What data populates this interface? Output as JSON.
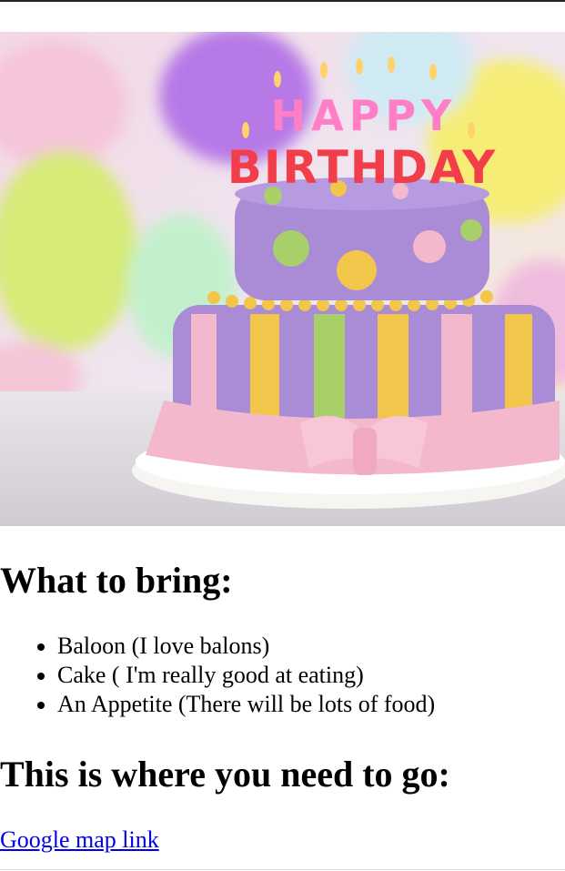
{
  "hero": {
    "candle_text_top": "HAPPY",
    "candle_text_bottom": "BIRTHDAY"
  },
  "bring": {
    "heading": "What to bring:",
    "items": [
      "Baloon (I love balons)",
      "Cake ( I'm really good at eating)",
      "An Appetite (There will be lots of food)"
    ]
  },
  "directions": {
    "heading": "This is where you need to go:",
    "link_label": "Google map link"
  },
  "colors": {
    "link": "#0000ee",
    "cake_lavender": "#a98bd6",
    "cake_pink": "#f4b8cc",
    "cake_yellow": "#f2c64a",
    "cake_green": "#a8cf6a"
  }
}
